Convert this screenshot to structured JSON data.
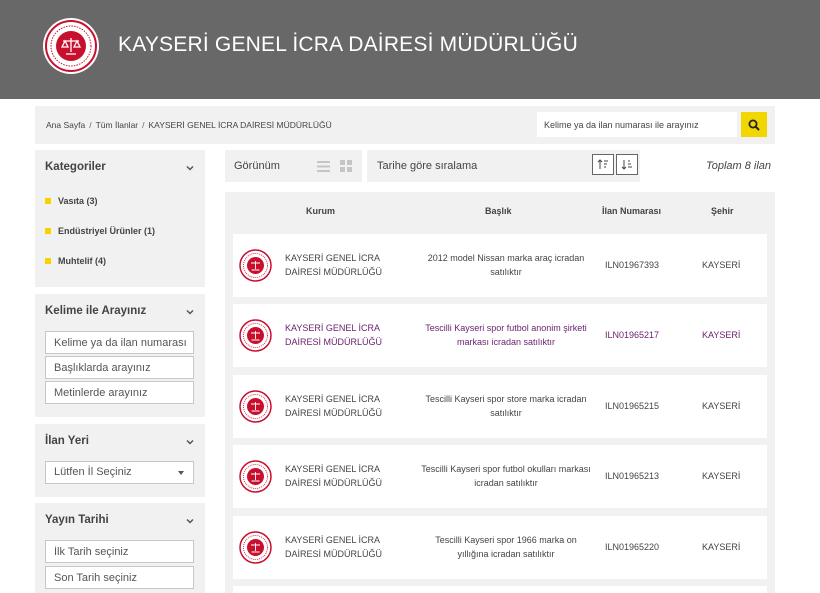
{
  "header": {
    "title": "KAYSERİ GENEL İCRA DAİRESİ MÜDÜRLÜĞÜ"
  },
  "breadcrumb": {
    "home": "Ana Sayfa",
    "all": "Tüm İlanlar",
    "current": "KAYSERİ GENEL İCRA DAİRESİ MÜDÜRLÜĞÜ"
  },
  "search": {
    "placeholder": "Kelime ya da ilan numarası ile arayınız"
  },
  "sidebar": {
    "categories": {
      "title": "Kategoriler",
      "items": [
        {
          "label": "Vasıta (3)"
        },
        {
          "label": "Endüstriyel Ürünler (1)"
        },
        {
          "label": "Muhtelif (4)"
        }
      ]
    },
    "keyword": {
      "title": "Kelime ile Arayınız",
      "fields": [
        {
          "placeholder": "Kelime ya da ilan numarası"
        },
        {
          "placeholder": "Başlıklarda arayınız"
        },
        {
          "placeholder": "Metinlerde arayınız"
        }
      ]
    },
    "location": {
      "title": "İlan Yeri",
      "select": "Lütfen İl Seçiniz"
    },
    "date": {
      "title": "Yayın Tarihi",
      "start": "İlk Tarih seçiniz",
      "end": "Son Tarih seçiniz"
    }
  },
  "toolbar": {
    "view_label": "Görünüm",
    "sort_label": "Tarihe göre sıralama",
    "total": "Toplam 8 ilan"
  },
  "table": {
    "headers": {
      "kurum": "Kurum",
      "baslik": "Başlık",
      "ilan_no": "İlan Numarası",
      "sehir": "Şehir"
    },
    "rows": [
      {
        "kurum": "KAYSERİ GENEL İCRA DAİRESİ MÜDÜRLÜĞÜ",
        "baslik": "2012 model Nissan marka araç icradan satılıktır",
        "ilan_no": "ILN01967393",
        "sehir": "KAYSERİ"
      },
      {
        "kurum": "KAYSERİ GENEL İCRA DAİRESİ MÜDÜRLÜĞÜ",
        "baslik": "Tescilli Kayseri spor futbol anonim şirketi markası icradan satılıktır",
        "ilan_no": "ILN01965217",
        "sehir": "KAYSERİ"
      },
      {
        "kurum": "KAYSERİ GENEL İCRA DAİRESİ MÜDÜRLÜĞÜ",
        "baslik": "Tescilli Kayseri spor store marka icradan satılıktır",
        "ilan_no": "ILN01965215",
        "sehir": "KAYSERİ"
      },
      {
        "kurum": "KAYSERİ GENEL İCRA DAİRESİ MÜDÜRLÜĞÜ",
        "baslik": "Tescilli Kayseri spor futbol okulları markası icradan satılıktır",
        "ilan_no": "ILN01965213",
        "sehir": "KAYSERİ"
      },
      {
        "kurum": "KAYSERİ GENEL İCRA DAİRESİ MÜDÜRLÜĞÜ",
        "baslik": "Tescilli Kayseri spor 1966 marka on yıllığına icradan satılıktır",
        "ilan_no": "ILN01965220",
        "sehir": "KAYSERİ"
      }
    ]
  },
  "colors": {
    "header_bg": "#686868",
    "accent_yellow": "#f1d600",
    "seal_red": "#c8102e",
    "panel_bg": "#f1f1f1",
    "visited_purple": "#6b1e6e"
  }
}
